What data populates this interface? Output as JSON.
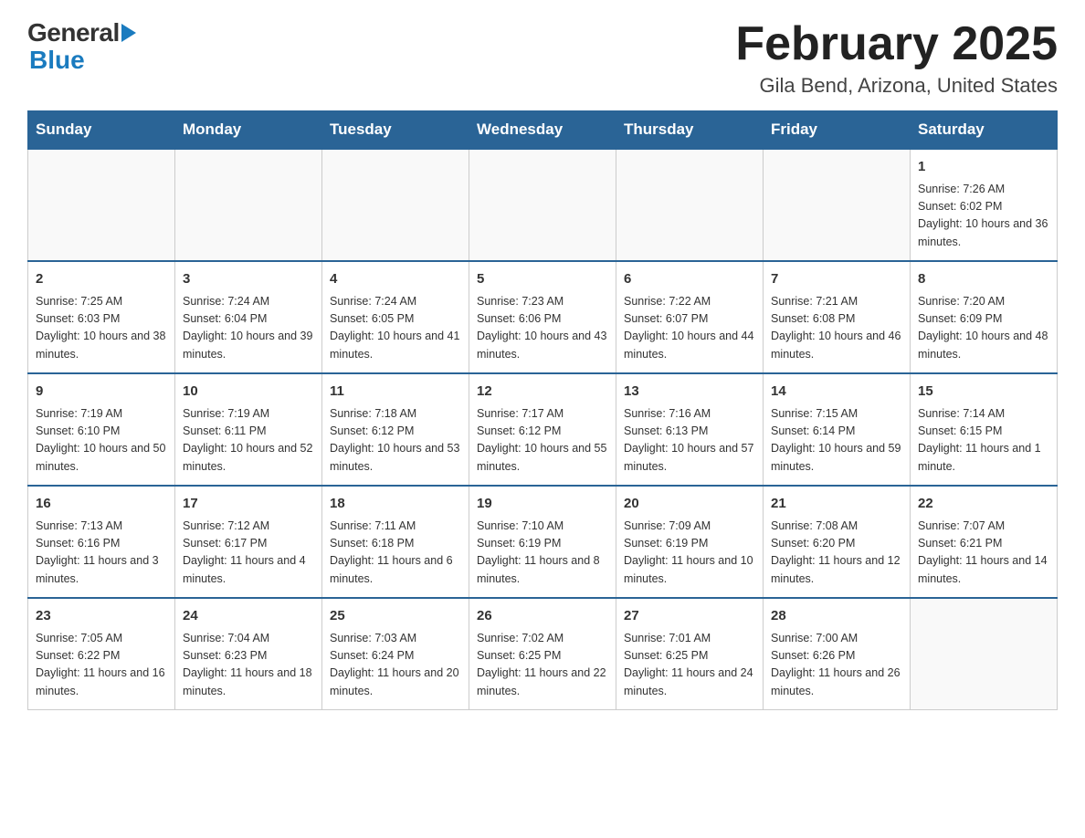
{
  "header": {
    "logo_general": "General",
    "logo_blue": "Blue",
    "title": "February 2025",
    "subtitle": "Gila Bend, Arizona, United States"
  },
  "days_of_week": [
    "Sunday",
    "Monday",
    "Tuesday",
    "Wednesday",
    "Thursday",
    "Friday",
    "Saturday"
  ],
  "weeks": [
    [
      {
        "day": "",
        "info": ""
      },
      {
        "day": "",
        "info": ""
      },
      {
        "day": "",
        "info": ""
      },
      {
        "day": "",
        "info": ""
      },
      {
        "day": "",
        "info": ""
      },
      {
        "day": "",
        "info": ""
      },
      {
        "day": "1",
        "info": "Sunrise: 7:26 AM\nSunset: 6:02 PM\nDaylight: 10 hours and 36 minutes."
      }
    ],
    [
      {
        "day": "2",
        "info": "Sunrise: 7:25 AM\nSunset: 6:03 PM\nDaylight: 10 hours and 38 minutes."
      },
      {
        "day": "3",
        "info": "Sunrise: 7:24 AM\nSunset: 6:04 PM\nDaylight: 10 hours and 39 minutes."
      },
      {
        "day": "4",
        "info": "Sunrise: 7:24 AM\nSunset: 6:05 PM\nDaylight: 10 hours and 41 minutes."
      },
      {
        "day": "5",
        "info": "Sunrise: 7:23 AM\nSunset: 6:06 PM\nDaylight: 10 hours and 43 minutes."
      },
      {
        "day": "6",
        "info": "Sunrise: 7:22 AM\nSunset: 6:07 PM\nDaylight: 10 hours and 44 minutes."
      },
      {
        "day": "7",
        "info": "Sunrise: 7:21 AM\nSunset: 6:08 PM\nDaylight: 10 hours and 46 minutes."
      },
      {
        "day": "8",
        "info": "Sunrise: 7:20 AM\nSunset: 6:09 PM\nDaylight: 10 hours and 48 minutes."
      }
    ],
    [
      {
        "day": "9",
        "info": "Sunrise: 7:19 AM\nSunset: 6:10 PM\nDaylight: 10 hours and 50 minutes."
      },
      {
        "day": "10",
        "info": "Sunrise: 7:19 AM\nSunset: 6:11 PM\nDaylight: 10 hours and 52 minutes."
      },
      {
        "day": "11",
        "info": "Sunrise: 7:18 AM\nSunset: 6:12 PM\nDaylight: 10 hours and 53 minutes."
      },
      {
        "day": "12",
        "info": "Sunrise: 7:17 AM\nSunset: 6:12 PM\nDaylight: 10 hours and 55 minutes."
      },
      {
        "day": "13",
        "info": "Sunrise: 7:16 AM\nSunset: 6:13 PM\nDaylight: 10 hours and 57 minutes."
      },
      {
        "day": "14",
        "info": "Sunrise: 7:15 AM\nSunset: 6:14 PM\nDaylight: 10 hours and 59 minutes."
      },
      {
        "day": "15",
        "info": "Sunrise: 7:14 AM\nSunset: 6:15 PM\nDaylight: 11 hours and 1 minute."
      }
    ],
    [
      {
        "day": "16",
        "info": "Sunrise: 7:13 AM\nSunset: 6:16 PM\nDaylight: 11 hours and 3 minutes."
      },
      {
        "day": "17",
        "info": "Sunrise: 7:12 AM\nSunset: 6:17 PM\nDaylight: 11 hours and 4 minutes."
      },
      {
        "day": "18",
        "info": "Sunrise: 7:11 AM\nSunset: 6:18 PM\nDaylight: 11 hours and 6 minutes."
      },
      {
        "day": "19",
        "info": "Sunrise: 7:10 AM\nSunset: 6:19 PM\nDaylight: 11 hours and 8 minutes."
      },
      {
        "day": "20",
        "info": "Sunrise: 7:09 AM\nSunset: 6:19 PM\nDaylight: 11 hours and 10 minutes."
      },
      {
        "day": "21",
        "info": "Sunrise: 7:08 AM\nSunset: 6:20 PM\nDaylight: 11 hours and 12 minutes."
      },
      {
        "day": "22",
        "info": "Sunrise: 7:07 AM\nSunset: 6:21 PM\nDaylight: 11 hours and 14 minutes."
      }
    ],
    [
      {
        "day": "23",
        "info": "Sunrise: 7:05 AM\nSunset: 6:22 PM\nDaylight: 11 hours and 16 minutes."
      },
      {
        "day": "24",
        "info": "Sunrise: 7:04 AM\nSunset: 6:23 PM\nDaylight: 11 hours and 18 minutes."
      },
      {
        "day": "25",
        "info": "Sunrise: 7:03 AM\nSunset: 6:24 PM\nDaylight: 11 hours and 20 minutes."
      },
      {
        "day": "26",
        "info": "Sunrise: 7:02 AM\nSunset: 6:25 PM\nDaylight: 11 hours and 22 minutes."
      },
      {
        "day": "27",
        "info": "Sunrise: 7:01 AM\nSunset: 6:25 PM\nDaylight: 11 hours and 24 minutes."
      },
      {
        "day": "28",
        "info": "Sunrise: 7:00 AM\nSunset: 6:26 PM\nDaylight: 11 hours and 26 minutes."
      },
      {
        "day": "",
        "info": ""
      }
    ]
  ]
}
